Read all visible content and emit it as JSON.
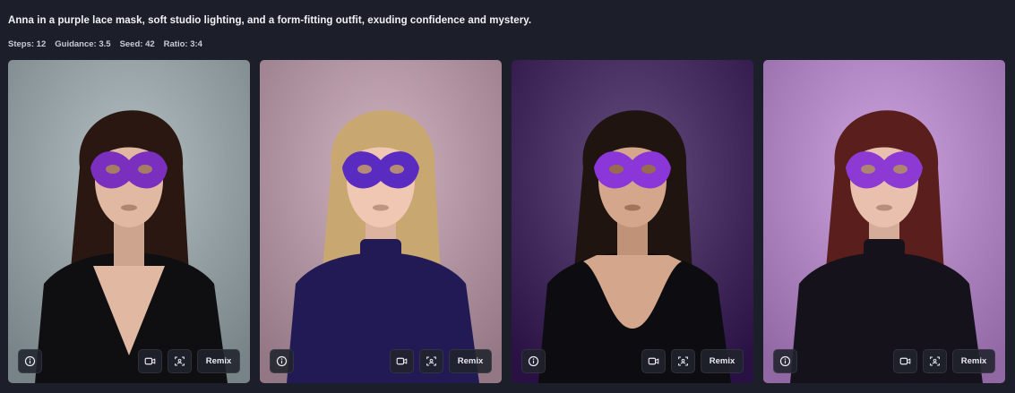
{
  "prompt": "Anna in a purple lace mask, soft studio lighting, and a form-fitting outfit, exuding confidence and mystery.",
  "params": {
    "steps": "Steps: 12",
    "guidance": "Guidance: 3.5",
    "seed": "Seed: 42",
    "ratio": "Ratio: 3:4"
  },
  "cards": [
    {
      "remix_label": "Remix",
      "bg": "#9aa6a9",
      "hair": "#2a1712",
      "outfit": "#0f0f12",
      "skin": "#e1b8a2",
      "mask": "#7a2fbf",
      "neckline": "v-neck"
    },
    {
      "remix_label": "Remix",
      "bg": "#b79aa8",
      "hair": "#c8a770",
      "outfit": "#221a55",
      "skin": "#efc7b3",
      "mask": "#5a2bc0",
      "neckline": "turtleneck"
    },
    {
      "remix_label": "Remix",
      "bg": "#4c3466",
      "hair": "#1f1410",
      "outfit": "#0d0c10",
      "skin": "#d4a68c",
      "mask": "#8a36d8",
      "neckline": "tank"
    },
    {
      "remix_label": "Remix",
      "bg": "#b48bc7",
      "hair": "#5a1f1c",
      "outfit": "#16121c",
      "skin": "#e8c0ad",
      "mask": "#8d3ad4",
      "neckline": "turtleneck"
    }
  ],
  "icons": {
    "info": "info-icon",
    "video": "video-icon",
    "focus": "focus-icon"
  }
}
